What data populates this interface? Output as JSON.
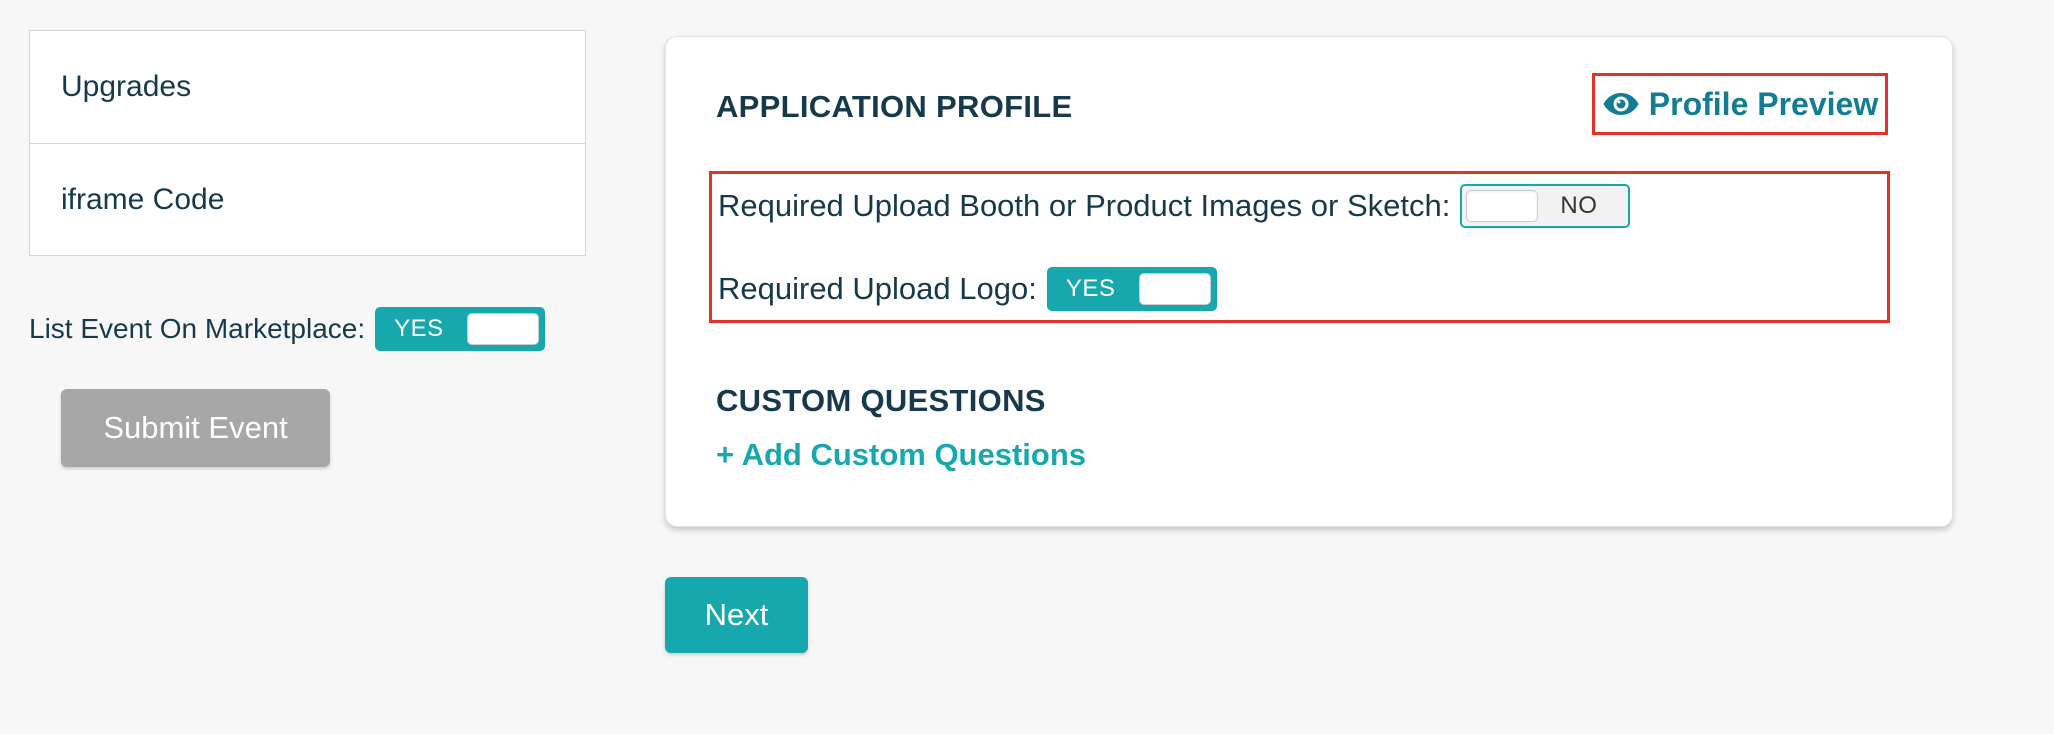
{
  "sidebar": {
    "items": [
      {
        "label": "Upgrades"
      },
      {
        "label": "iframe Code"
      }
    ]
  },
  "marketplace": {
    "label": "List Event On Marketplace:",
    "toggle_text": "YES",
    "enabled": true
  },
  "submit": {
    "label": "Submit Event"
  },
  "application_profile": {
    "title": "APPLICATION PROFILE",
    "preview_label": "Profile Preview",
    "preview_icon": "eye-icon",
    "booth_images": {
      "label": "Required Upload Booth or Product Images or Sketch:",
      "toggle_text": "NO",
      "enabled": false
    },
    "logo": {
      "label": "Required Upload Logo:",
      "toggle_text": "YES",
      "enabled": true
    }
  },
  "custom_questions": {
    "title": "CUSTOM QUESTIONS",
    "add_label": "+ Add Custom Questions"
  },
  "next": {
    "label": "Next"
  },
  "colors": {
    "accent": "#17a8ae",
    "link": "#137d93",
    "text": "#163a4a",
    "highlight_box": "#e53227",
    "disabled_button": "#a7a7a7",
    "background": "#f7f7f7"
  }
}
